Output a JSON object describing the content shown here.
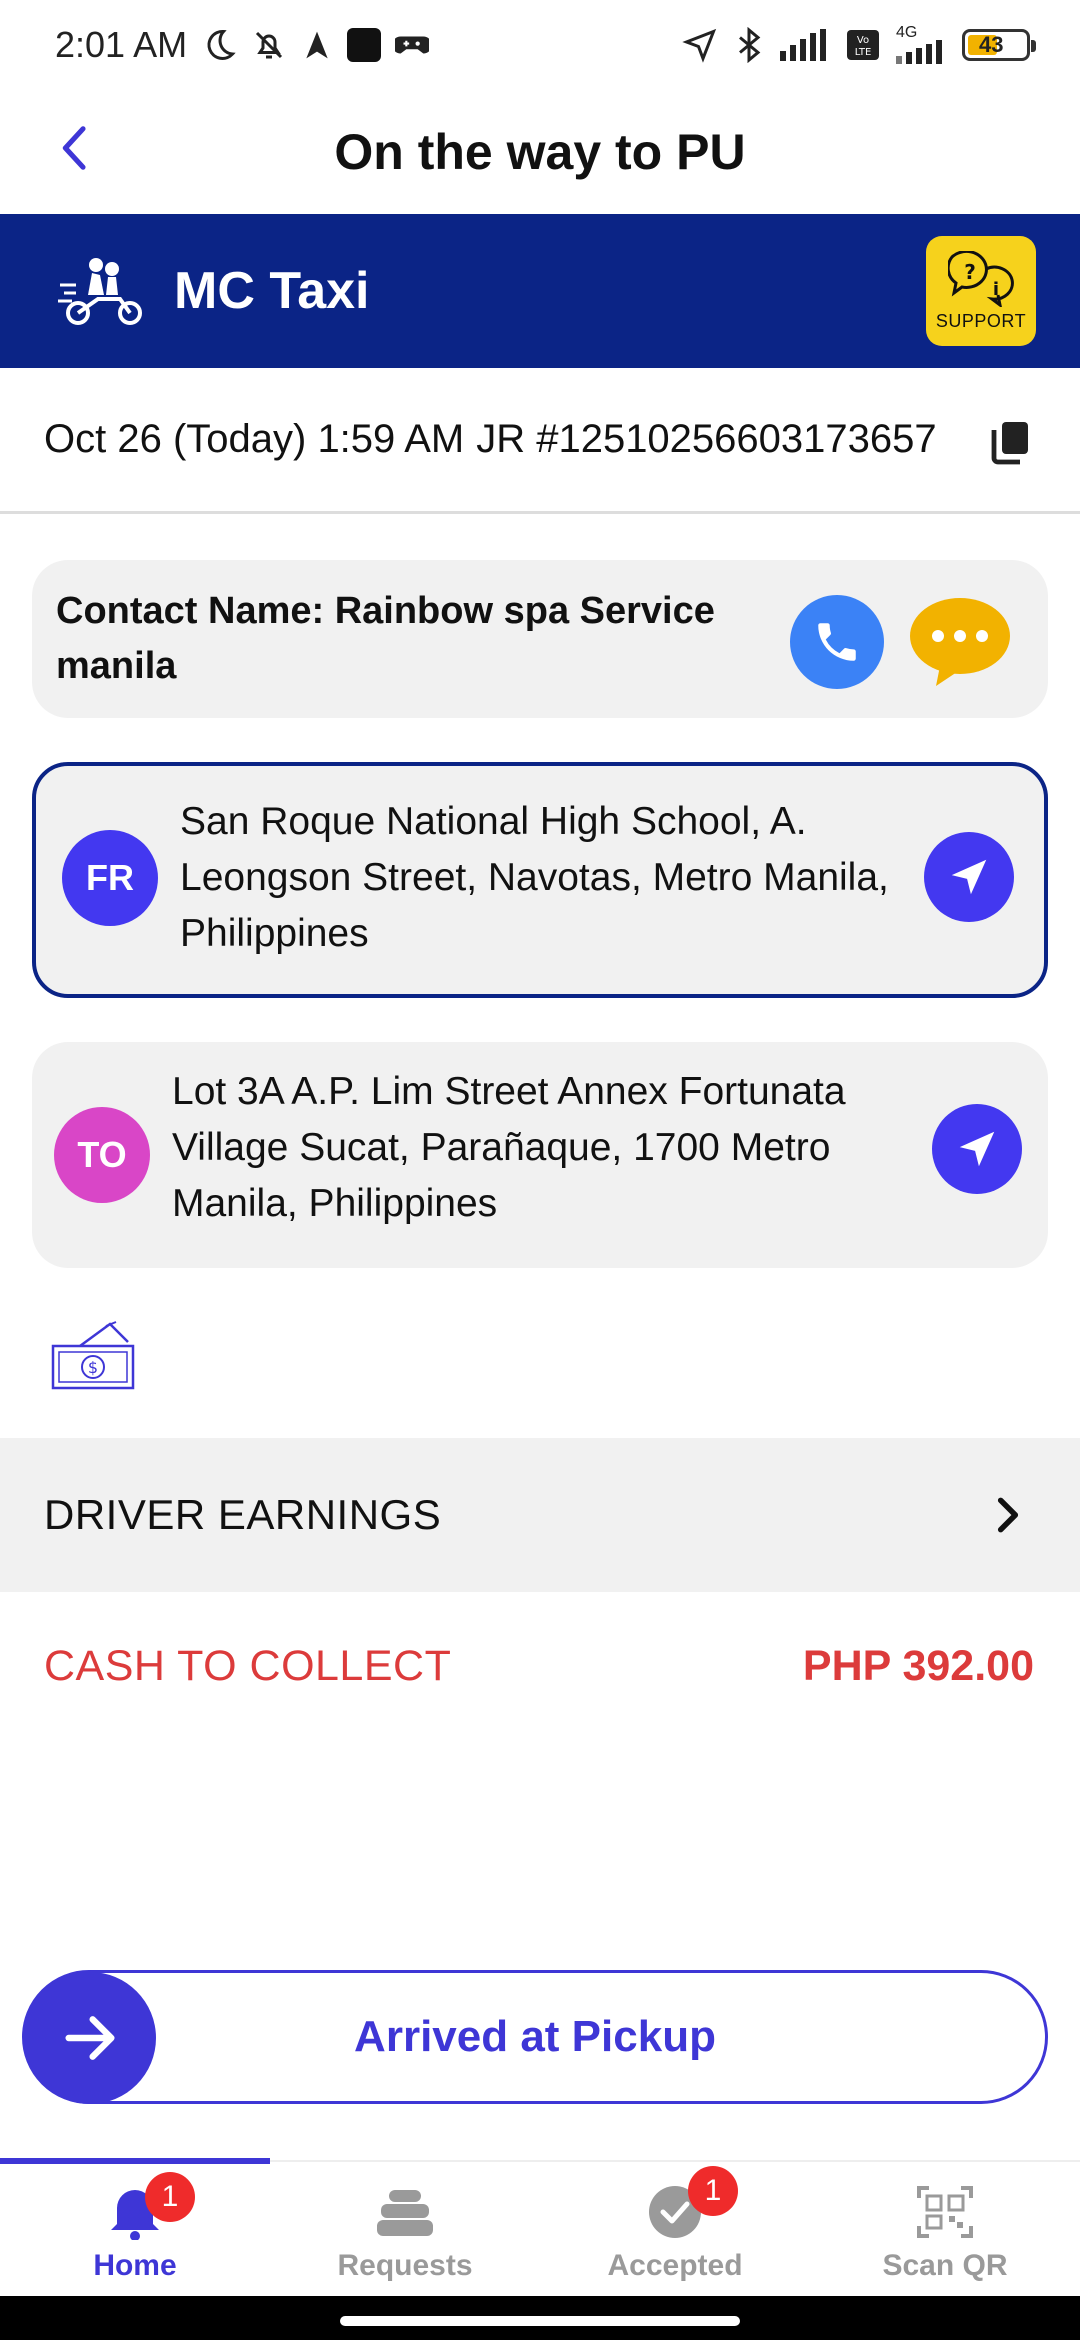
{
  "status_bar": {
    "time": "2:01 AM",
    "network": "4G",
    "battery": "43"
  },
  "header": {
    "title": "On the way to PU"
  },
  "banner": {
    "service": "MC Taxi",
    "support_label": "SUPPORT"
  },
  "trip": {
    "date_time": "Oct 26 (Today) 1:59 AM",
    "job_ref": "JR #12510256603173657"
  },
  "contact": {
    "name": "Contact Name: Rainbow spa Service manila"
  },
  "pickup": {
    "badge": "FR",
    "address": "San Roque National High School, A. Leongson Street, Navotas, Metro Manila, Philippines"
  },
  "dropoff": {
    "badge": "TO",
    "address": "Lot 3A A.P. Lim Street Annex Fortunata Village Sucat, Parañaque, 1700 Metro Manila, Philippines"
  },
  "earnings": {
    "label": "DRIVER EARNINGS"
  },
  "cash": {
    "label": "CASH TO COLLECT",
    "value": "PHP 392.00"
  },
  "action": {
    "label": "Arrived at Pickup"
  },
  "bottom_nav": {
    "items": [
      {
        "label": "Home",
        "icon": "bell-icon",
        "badge": "1",
        "active": true
      },
      {
        "label": "Requests",
        "icon": "stack-icon",
        "badge": "",
        "active": false
      },
      {
        "label": "Accepted",
        "icon": "check-circle-icon",
        "badge": "1",
        "active": false
      },
      {
        "label": "Scan QR",
        "icon": "qr-code-icon",
        "badge": "",
        "active": false
      }
    ]
  },
  "colors": {
    "brand_blue": "#0b2486",
    "accent_purple": "#3e36d6",
    "cash_red": "#dc3b3b",
    "support_yellow": "#f6d21c",
    "badge_red": "#ef2b2b"
  }
}
